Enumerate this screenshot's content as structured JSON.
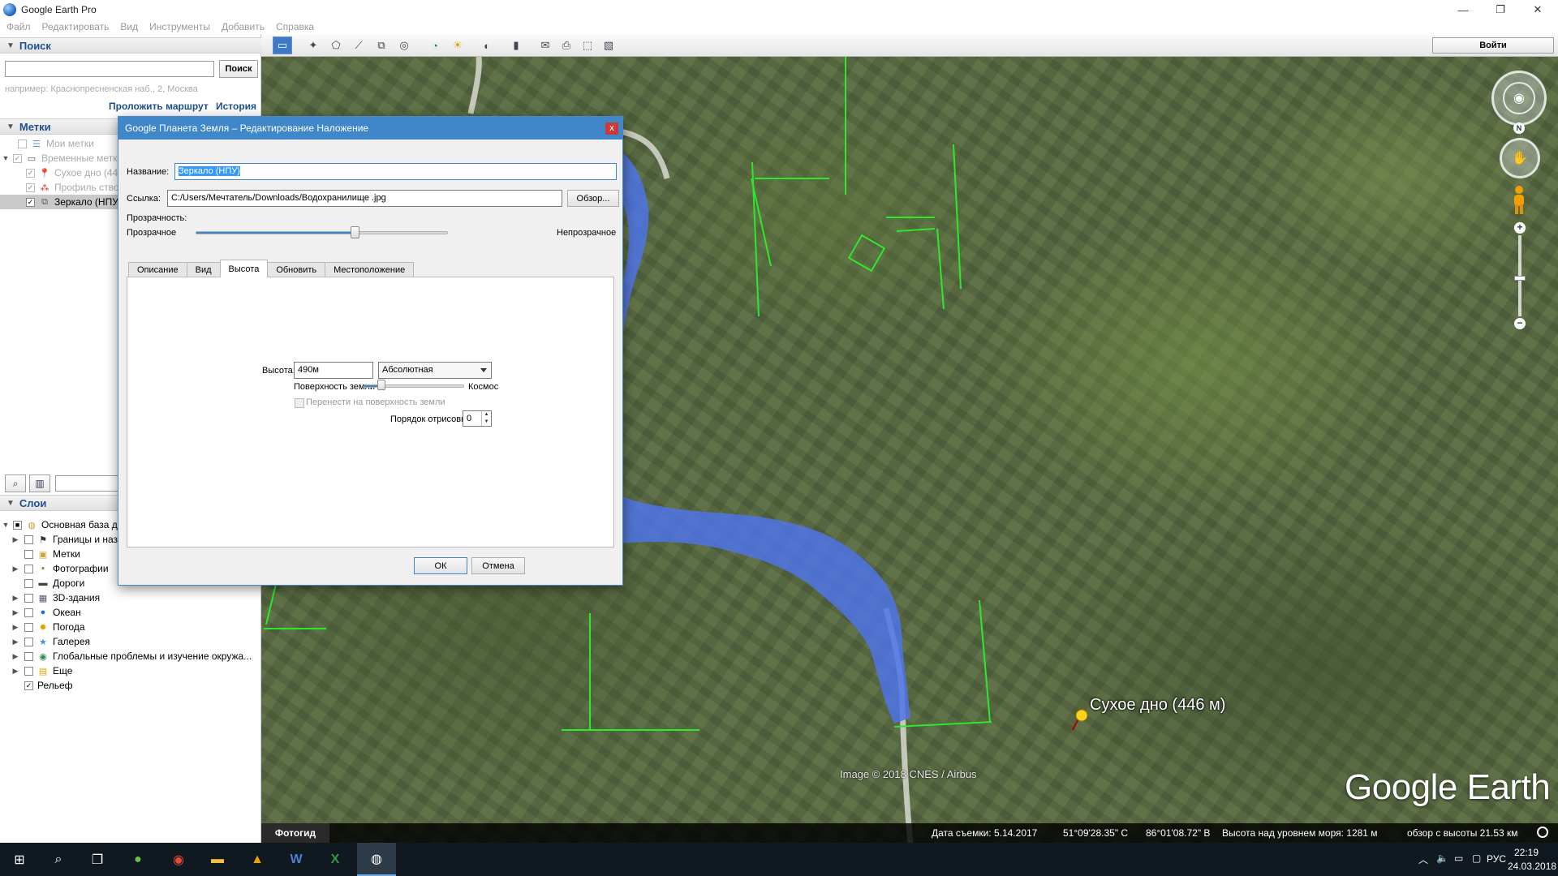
{
  "app": {
    "title": "Google Earth Pro"
  },
  "menu": [
    "Файл",
    "Редактировать",
    "Вид",
    "Инструменты",
    "Добавить",
    "Справка"
  ],
  "search": {
    "header": "Поиск",
    "button": "Поиск",
    "input_value": "",
    "hint": "например: Краснопресненская наб., 2, Москва",
    "route_link": "Проложить маршрут",
    "history_link": "История"
  },
  "places": {
    "header": "Метки",
    "items": [
      {
        "label": "Мои метки",
        "checked": false,
        "dim": true,
        "expander": ""
      },
      {
        "label": "Временные метки",
        "checked": true,
        "dim": true,
        "expander": "▼"
      },
      {
        "label": "Сухое дно (446 м)",
        "checked": true,
        "dim": true,
        "expander": ""
      },
      {
        "label": "Профиль ство",
        "checked": true,
        "dim": true,
        "expander": ""
      },
      {
        "label": "Зеркало (НПУ)",
        "checked": true,
        "dim": false,
        "expander": "",
        "selected": true
      }
    ]
  },
  "layers": {
    "header": "Слои",
    "items": [
      {
        "label": "Основная база данных",
        "icon": "globe-icon"
      },
      {
        "label": "Границы и названия",
        "icon": "flag-icon"
      },
      {
        "label": "Метки",
        "icon": "label-icon"
      },
      {
        "label": "Фотографии",
        "icon": "photo-icon"
      },
      {
        "label": "Дороги",
        "icon": "road-icon"
      },
      {
        "label": "3D-здания",
        "icon": "building-icon"
      },
      {
        "label": "Океан",
        "icon": "ocean-icon"
      },
      {
        "label": "Погода",
        "icon": "weather-icon"
      },
      {
        "label": "Галерея",
        "icon": "gallery-icon"
      },
      {
        "label": "Глобальные проблемы и изучение окружа...",
        "icon": "earth-icon"
      },
      {
        "label": "Еще",
        "icon": "more-icon"
      },
      {
        "label": "Рельеф",
        "icon": ""
      }
    ]
  },
  "toolbar": {
    "login": "Войти"
  },
  "dialog": {
    "title": "Google Планета Земля – Редактирование Наложение",
    "close": "x",
    "name_label": "Название:",
    "name_value": "Зеркало (НПУ)",
    "link_label": "Ссылка:",
    "link_value": "C:/Users/Мечтатель/Downloads/Водохранилище .jpg",
    "browse": "Обзор...",
    "opacity_label": "Прозрачность:",
    "opacity_left": "Прозрачное",
    "opacity_right": "Непрозрачное",
    "opacity_value": 0.63,
    "tabs": [
      "Описание",
      "Вид",
      "Высота",
      "Обновить",
      "Местоположение"
    ],
    "active_tab": 2,
    "altitude_label": "Высота:",
    "altitude_value": "490м",
    "altitude_mode": "Абсолютная",
    "surface_left": "Поверхность земли",
    "surface_right": "Космос",
    "surface_value": 0.18,
    "clamp_label": "Перенести на поверхность земли",
    "draw_order_label": "Порядок отрисовки:",
    "draw_order_value": "0",
    "ok": "ОК",
    "cancel": "Отмена"
  },
  "map": {
    "credit": "Image © 2018 CNES / Airbus",
    "brand": "Google Earth",
    "pin_label": "Сухое дно (446 м)",
    "compass_n": "N"
  },
  "status": {
    "tour": "Фотогид",
    "date": "Дата съемки: 5.14.2017",
    "lat": "51°09'28.35\" С",
    "lon": "86°01'08.72\" В",
    "elev": "Высота над уровнем моря:  1281 м",
    "eye": "обзор с высоты  21.53 км"
  },
  "taskbar": {
    "lang": "РУС",
    "time": "22:19",
    "date": "24.03.2018"
  },
  "colors": {
    "accent": "#3f87c8",
    "river": "#4f74e8",
    "line": "#2ee82e"
  }
}
